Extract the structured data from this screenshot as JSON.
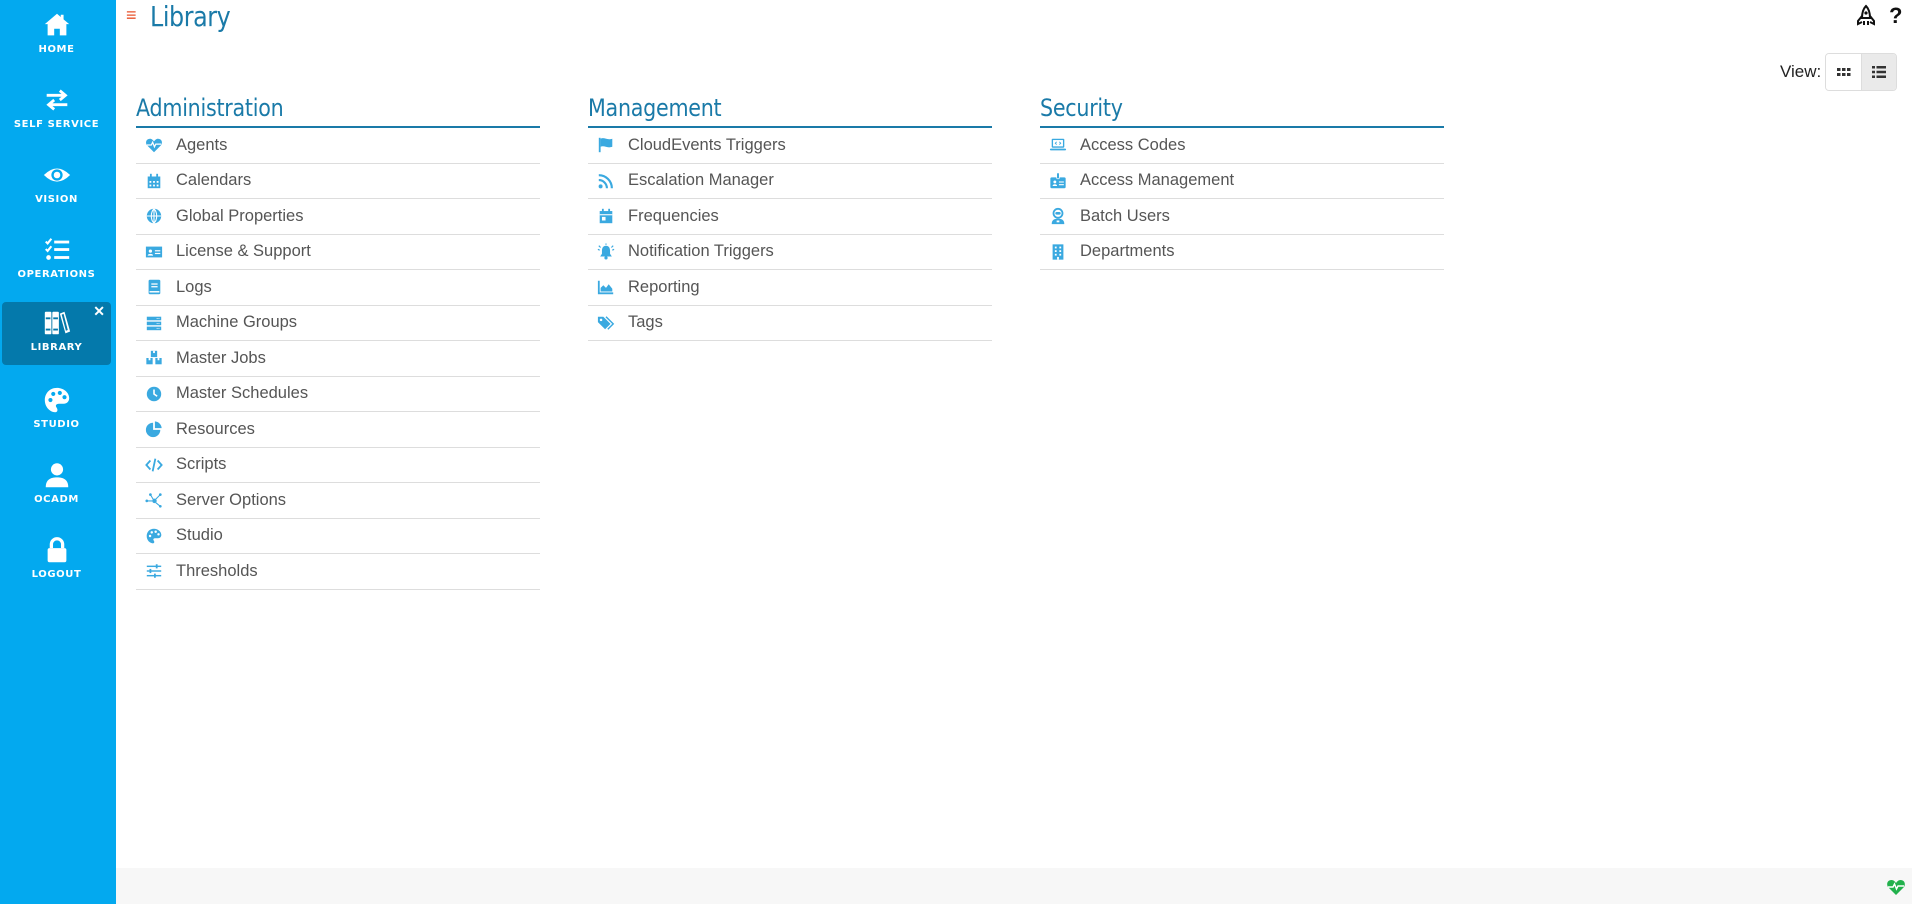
{
  "colors": {
    "sidebar_bg": "#03a9ef",
    "sidebar_active_bg": "#0479ab",
    "accent": "#1a7aa8",
    "icon": "#3aa9e0",
    "menu_toggle": "#e8532b",
    "status_ok": "#22b14c"
  },
  "sidebar": {
    "items": [
      {
        "label": "HOME",
        "icon": "home-icon"
      },
      {
        "label": "SELF SERVICE",
        "icon": "exchange-arrows-icon"
      },
      {
        "label": "VISION",
        "icon": "eye-icon"
      },
      {
        "label": "OPERATIONS",
        "icon": "checklist-icon"
      },
      {
        "label": "LIBRARY",
        "icon": "books-icon",
        "active": true,
        "close": "✕"
      },
      {
        "label": "STUDIO",
        "icon": "palette-icon"
      },
      {
        "label": "OCADM",
        "icon": "user-icon"
      },
      {
        "label": "LOGOUT",
        "icon": "lock-icon"
      }
    ]
  },
  "header": {
    "menu_glyph": "≡",
    "title": "Library",
    "rocket_icon": "rocket-icon",
    "help_glyph": "?"
  },
  "view": {
    "label": "View:",
    "options": [
      "grid",
      "list"
    ],
    "selected": "list"
  },
  "columns": [
    {
      "title": "Administration",
      "items": [
        {
          "label": "Agents",
          "icon": "heartbeat-icon"
        },
        {
          "label": "Calendars",
          "icon": "calendar-icon"
        },
        {
          "label": "Global Properties",
          "icon": "globe-icon"
        },
        {
          "label": "License & Support",
          "icon": "id-card-icon"
        },
        {
          "label": "Logs",
          "icon": "book-icon"
        },
        {
          "label": "Machine Groups",
          "icon": "server-icon"
        },
        {
          "label": "Master Jobs",
          "icon": "boxes-icon"
        },
        {
          "label": "Master Schedules",
          "icon": "clock-icon"
        },
        {
          "label": "Resources",
          "icon": "pie-chart-icon"
        },
        {
          "label": "Scripts",
          "icon": "code-icon"
        },
        {
          "label": "Server Options",
          "icon": "network-icon"
        },
        {
          "label": "Studio",
          "icon": "palette-icon"
        },
        {
          "label": "Thresholds",
          "icon": "sliders-icon"
        }
      ]
    },
    {
      "title": "Management",
      "items": [
        {
          "label": "CloudEvents Triggers",
          "icon": "flag-icon"
        },
        {
          "label": "Escalation Manager",
          "icon": "rss-icon"
        },
        {
          "label": "Frequencies",
          "icon": "calendar-day-icon"
        },
        {
          "label": "Notification Triggers",
          "icon": "bell-ringing-icon"
        },
        {
          "label": "Reporting",
          "icon": "area-chart-icon"
        },
        {
          "label": "Tags",
          "icon": "tags-icon"
        }
      ]
    },
    {
      "title": "Security",
      "items": [
        {
          "label": "Access Codes",
          "icon": "laptop-code-icon"
        },
        {
          "label": "Access Management",
          "icon": "id-badge-icon"
        },
        {
          "label": "Batch Users",
          "icon": "robot-user-icon"
        },
        {
          "label": "Departments",
          "icon": "building-icon"
        }
      ]
    }
  ],
  "footer": {
    "status_icon": "heartbeat-status-icon"
  }
}
